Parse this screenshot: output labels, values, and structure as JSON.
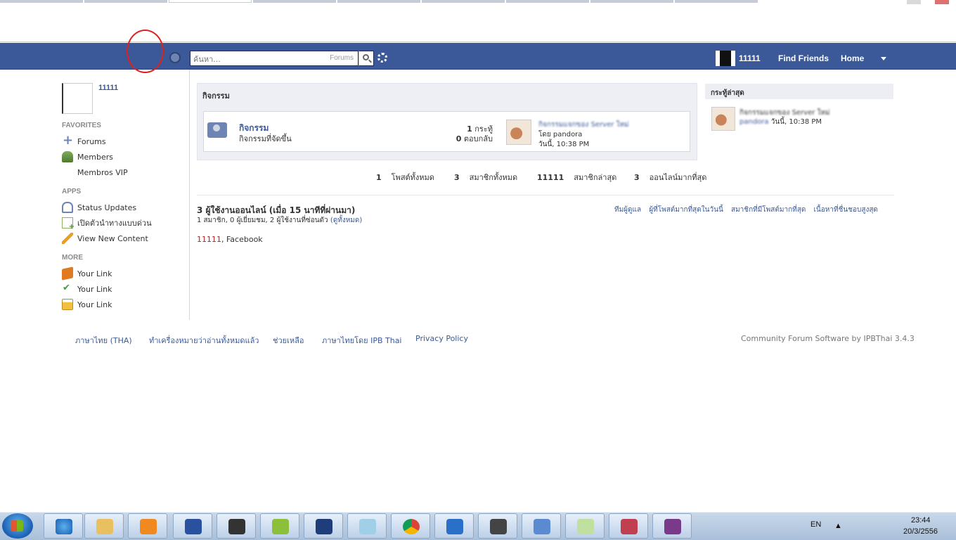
{
  "header": {
    "search_placeholder": "ค้นหา...",
    "search_scope": "Forums",
    "username": "11111",
    "find_friends": "Find Friends",
    "home": "Home"
  },
  "sidebar": {
    "profile_name": "11111",
    "favorites_heading": "FAVORITES",
    "favorites": [
      "Forums",
      "Members",
      "Membros VIP"
    ],
    "apps_heading": "APPS",
    "apps": [
      "Status Updates",
      "เปิดตัวนำทางแบบด่วน",
      "View New Content"
    ],
    "more_heading": "MORE",
    "more": [
      "Your Link",
      "Your Link",
      "Your Link"
    ]
  },
  "category": {
    "title": "กิจกรรม",
    "forum_name": "กิจกรรม",
    "forum_desc": "กิจกรรมที่จัดขึ้น",
    "topics_count": "1",
    "topics_label": "กระทู้",
    "replies_count": "0",
    "replies_label": "ตอบกลับ",
    "last_title": "กิจกรรมแจกของ Server ใหม่",
    "last_by": "โดย pandora",
    "last_time": "วันนี้, 10:38 PM"
  },
  "stats": [
    {
      "value": "1",
      "label": "โพสต์ทั้งหมด"
    },
    {
      "value": "3",
      "label": "สมาชิกทั้งหมด"
    },
    {
      "value": "11111",
      "label": "สมาชิกล่าสุด"
    },
    {
      "value": "3",
      "label": "ออนไลน์มากที่สุด"
    }
  ],
  "online": {
    "title": "3 ผู้ใช้งานออนไลน์ (เมื่อ 15 นาทีที่ผ่านมา)",
    "sub": "1 สมาชิก, 0 ผู้เยี่ยมชม, 2 ผู้ใช้งานที่ซ่อนตัว",
    "view_all": "(ดูทั้งหมด)",
    "user_1": "11111",
    "user_2": ", Facebook",
    "links": [
      "ทีมผู้ดูแล",
      "ผู้ที่โพสต์มากที่สุดในวันนี้",
      "สมาชิกที่มีโพสต์มากที่สุด",
      "เนื้อหาที่ชื่นชอบสูงสุด"
    ]
  },
  "recent": {
    "heading": "กระทู้ล่าสุด",
    "title": "กิจกรรมแจกของ Server ใหม่",
    "by": "pandora",
    "time": "วันนี้, 10:38 PM"
  },
  "footer": {
    "links": [
      "ภาษาไทย (THA)",
      "ทำเครื่องหมายว่าอ่านทั้งหมดแล้ว",
      "ช่วยเหลือ",
      "ภาษาไทยโดย IPB Thai",
      "Privacy Policy"
    ],
    "credit": "Community Forum Software by IPBThai 3.4.3"
  },
  "taskbar": {
    "lang": "EN",
    "time": "23:44",
    "date": "20/3/2556"
  },
  "colors": {
    "brand_blue": "#3b5998",
    "annotation_red": "#e02020"
  }
}
